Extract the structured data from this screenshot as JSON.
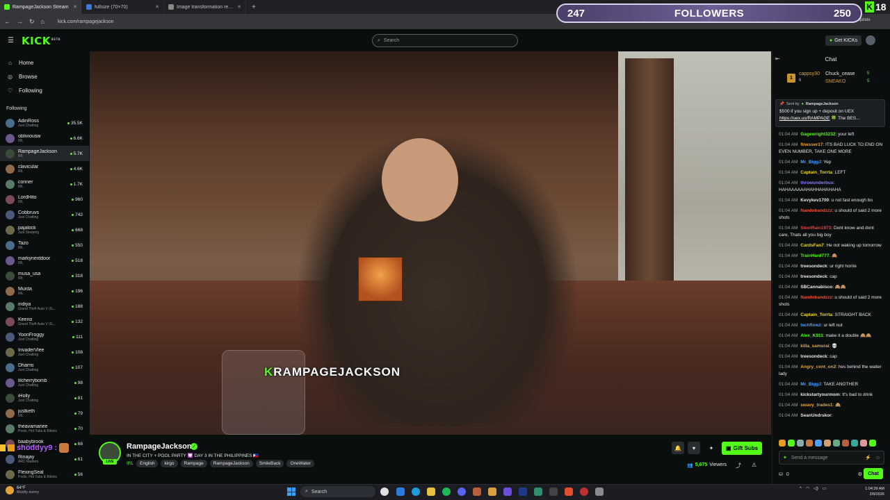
{
  "browser": {
    "tabs": [
      {
        "label": "RampageJackson Stream",
        "active": true
      },
      {
        "label": "fullsize (70×70)",
        "active": false
      },
      {
        "label": "Image transformation request",
        "active": false
      }
    ],
    "url": "kick.com/rampagejackson",
    "update_label": "Click to update"
  },
  "overlay": {
    "followers_current": "247",
    "followers_label": "FOLLOWERS",
    "followers_goal": "250",
    "age_badge": "18",
    "user_tag": "shoddyy9 :",
    "watermark_k": "K",
    "watermark": "RAMPAGEJACKSON"
  },
  "header": {
    "logo": "KICK",
    "logo_badge": "BETA",
    "search_placeholder": "Search",
    "get_kicks": "Get KICKs"
  },
  "sidebar": {
    "nav": [
      {
        "label": "Home",
        "icon": "home-icon"
      },
      {
        "label": "Browse",
        "icon": "compass-icon"
      },
      {
        "label": "Following",
        "icon": "heart-icon"
      }
    ],
    "following_title": "Following",
    "channels": [
      {
        "name": "AdinRoss",
        "category": "Just Chatting",
        "viewers": "35.5K"
      },
      {
        "name": "obliviousw",
        "category": "IRL",
        "viewers": "6.6K"
      },
      {
        "name": "RampageJackson",
        "category": "IRL",
        "viewers": "5.7K",
        "selected": true
      },
      {
        "name": "clavicular",
        "category": "IRL",
        "viewers": "4.6K"
      },
      {
        "name": "conner",
        "category": "IRL",
        "viewers": "1.7K"
      },
      {
        "name": "LordHito",
        "category": "IRL",
        "viewers": "960"
      },
      {
        "name": "Cobbruvs",
        "category": "Just Chatting",
        "viewers": "742"
      },
      {
        "name": "pajalock",
        "category": "Just Sleeping",
        "viewers": "668"
      },
      {
        "name": "Tazo",
        "category": "IRL",
        "viewers": "550"
      },
      {
        "name": "markynextdoor",
        "category": "IRL",
        "viewers": "518"
      },
      {
        "name": "musa_usa",
        "category": "IRL",
        "viewers": "318"
      },
      {
        "name": "Murda",
        "category": "IRL",
        "viewers": "196"
      },
      {
        "name": "indiya",
        "category": "Grand Theft Auto V (G...",
        "viewers": "188"
      },
      {
        "name": "Keeno",
        "category": "Grand Theft Auto V (G...",
        "viewers": "132"
      },
      {
        "name": "YoonFroggy",
        "category": "Just Chatting",
        "viewers": "111"
      },
      {
        "name": "InvaderVlee",
        "category": "Just Chatting",
        "viewers": "108"
      },
      {
        "name": "Dharris",
        "category": "Just Chatting",
        "viewers": "107"
      },
      {
        "name": "lilcherrybomb",
        "category": "Just Chatting",
        "viewers": "98"
      },
      {
        "name": "iHolly",
        "category": "Just Chatting",
        "viewers": "81"
      },
      {
        "name": "justketh",
        "category": "IRL",
        "viewers": "79"
      },
      {
        "name": "theavamariee",
        "category": "Pools, Hot Tubs & Bikinis",
        "viewers": "70"
      },
      {
        "name": "baabybrook",
        "category": "Just Chatting",
        "viewers": "68"
      },
      {
        "name": "Rinajay",
        "category": "ARC Raiders",
        "viewers": "61"
      },
      {
        "name": "FlexingSeal",
        "category": "Pools, Hot Tubs & Bikinis",
        "viewers": "56"
      }
    ]
  },
  "stream": {
    "name": "RampageJackson",
    "live": "LIVE",
    "title": "IN THE CITY + POOL PARTY 💟 DAY 3 IN THE PHILIPPINES 🇵🇭",
    "category": "IRL",
    "tags": [
      "English",
      "kirgo",
      "Rampage",
      "RampageJackson",
      "SmileBack",
      "OneWater"
    ],
    "gift_subs": "Gift Subs",
    "viewers_num": "5,675",
    "viewers_label": "Viewers"
  },
  "chat": {
    "title": "Chat",
    "leaderboard": {
      "rank": "1",
      "first_user": "cappsy30",
      "first_count": "6",
      "second_user": "Chuck_cease",
      "second_count": "5",
      "third_user": "SNEAKO",
      "third_count": "5"
    },
    "pinned": {
      "sent_by": "Sent by",
      "user": "RampageJackson",
      "text": "$500 if you sign up + deposit on UEX",
      "link": "https://uex.us/RAMPAGE",
      "trail": "🍀 The BES..."
    },
    "messages": [
      {
        "ts": "01:04 AM",
        "user": "Gagewright3232",
        "color": "#53fc18",
        "text": "your left"
      },
      {
        "ts": "01:04 AM",
        "user": "finesser17",
        "color": "#e8a33d",
        "text": "ITS BAD LUCK TO END ON EVEN NUMBER, TAKE ONE MORE"
      },
      {
        "ts": "01:04 AM",
        "user": "Mr_BiggJ",
        "color": "#4f9dff",
        "text": "Yep"
      },
      {
        "ts": "01:04 AM",
        "user": "Captain_Torrta",
        "color": "#e8d53d",
        "text": "LEFT"
      },
      {
        "ts": "01:04 AM",
        "user": "throwunderbus",
        "color": "#8a7cff",
        "text": "HAHAAAAAAHAHHAHAHAHA"
      },
      {
        "ts": "01:04 AM",
        "user": "Kevykev1700",
        "color": "#e8e8e8",
        "text": "u not fast enough bo"
      },
      {
        "ts": "01:04 AM",
        "user": "Nandobandzzz",
        "color": "#e0553d",
        "text": "u should of said 2 more shots"
      },
      {
        "ts": "01:04 AM",
        "user": "SteelRain1973",
        "color": "#d14a4a",
        "text": "Dont know and dont care, Thats all you big boy"
      },
      {
        "ts": "01:04 AM",
        "user": "CardsFan7",
        "color": "#e8d53d",
        "text": "He not waking up tomorrow"
      },
      {
        "ts": "01:04 AM",
        "user": "TrainHard777",
        "color": "#53fc18",
        "text": "🙈"
      },
      {
        "ts": "01:04 AM",
        "user": "treesondeck",
        "color": "#e8e8e8",
        "text": "ur right horrie"
      },
      {
        "ts": "01:04 AM",
        "user": "treesondeck",
        "color": "#e8e8e8",
        "text": "cap"
      },
      {
        "ts": "01:04 AM",
        "user": "SBCannabisco",
        "color": "#e8e8e8",
        "text": "🙈🙈"
      },
      {
        "ts": "01:04 AM",
        "user": "Nandobandzzz",
        "color": "#e0553d",
        "text": "u should of said 2 more shots"
      },
      {
        "ts": "01:04 AM",
        "user": "Captain_Torrta",
        "color": "#e8d53d",
        "text": "STRAIGHT BACK"
      },
      {
        "ts": "01:04 AM",
        "user": "techflowz",
        "color": "#4f9dff",
        "text": "ur left nut"
      },
      {
        "ts": "01:04 AM",
        "user": "Alex_K911",
        "color": "#53fc18",
        "text": "make it a double 🙈🙈"
      },
      {
        "ts": "01:04 AM",
        "user": "killa_samurai",
        "color": "#e8a33d",
        "text": "💀"
      },
      {
        "ts": "01:04 AM",
        "user": "treesondeck",
        "color": "#e8e8e8",
        "text": "cap"
      },
      {
        "ts": "01:04 AM",
        "user": "Angry_cxnt_on2",
        "color": "#e8a33d",
        "text": "hes behind the waiter lady"
      },
      {
        "ts": "01:04 AM",
        "user": "Mr_BiggJ",
        "color": "#4f9dff",
        "text": "TAKE ANOTHER"
      },
      {
        "ts": "01:04 AM",
        "user": "kickstartyourmom",
        "color": "#e8e8e8",
        "text": "It's bad to drink"
      },
      {
        "ts": "01:04 AM",
        "user": "swavy_trades1",
        "color": "#e8a33d",
        "text": "🙈"
      },
      {
        "ts": "01:04 AM",
        "user": "SeanUndrskor",
        "color": "#e8e8e8",
        "text": ""
      }
    ],
    "input_placeholder": "Send a message",
    "kicks_count": "0",
    "chat_button": "Chat"
  },
  "taskbar": {
    "temp": "64°F",
    "weather": "Mostly sunny",
    "search": "Search",
    "time": "1:04:39 AM",
    "date": "2/8/2026"
  },
  "colors": {
    "accent": "#53fc18",
    "bg": "#0b0e0f"
  }
}
